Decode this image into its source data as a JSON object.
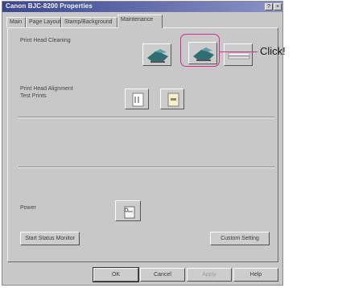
{
  "window": {
    "title": "Canon BJC-8200 Properties",
    "help_glyph": "?",
    "close_glyph": "×"
  },
  "tabs": [
    {
      "label": "Main"
    },
    {
      "label": "Page Layout"
    },
    {
      "label": "Stamp/Background"
    },
    {
      "label": "Maintenance",
      "active": true
    }
  ],
  "maintenance": {
    "print_head_cleaning_label": "Print Head Cleaning",
    "alignment_label": "Print Head Alignment\nTest Prints",
    "power_label": "Power",
    "start_status_monitor_label": "Start Status Monitor",
    "custom_setting_label": "Custom Setting",
    "icons": {
      "cleaning": "cleaning-icon",
      "deep_cleaning": "deep-cleaning-icon",
      "roller": "roller-cleaning-icon",
      "alignment": "print-head-alignment-icon",
      "nozzle_check": "nozzle-check-icon",
      "power": "power-off-icon"
    }
  },
  "footer": {
    "ok_label": "OK",
    "cancel_label": "Cancel",
    "apply_label": "Apply",
    "help_label": "Help"
  },
  "annotation": {
    "callout_text": "Click!",
    "color": "#d0308a"
  }
}
